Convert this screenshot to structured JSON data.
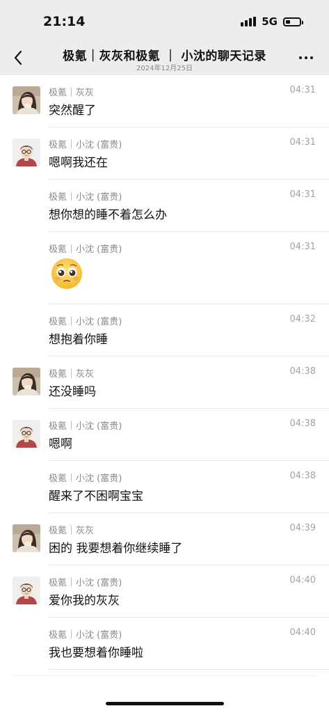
{
  "status_bar": {
    "time": "21:14",
    "network": "5G",
    "battery_level": 0.35,
    "signal_bars": 4
  },
  "nav": {
    "title": "极氪｜灰灰和极氪 ｜ 小沈的聊天记录",
    "date": "2024年12月25日",
    "back_icon": "chevron-left-icon",
    "more_icon": "more-horizontal-icon"
  },
  "messages": [
    {
      "sender": "极氪｜灰灰",
      "time": "04:31",
      "text": "突然醒了",
      "avatar": "girl-photo"
    },
    {
      "sender": "极氪｜小沈 (富贵)",
      "time": "04:31",
      "text": "嗯啊我还在",
      "avatar": "cartoon-boy"
    },
    {
      "sender": "极氪｜小沈 (富贵)",
      "time": "04:31",
      "text": "想你想的睡不着怎么办"
    },
    {
      "sender": "极氪｜小沈 (富贵)",
      "time": "04:31",
      "emoji": "pleading-face-emoji"
    },
    {
      "sender": "极氪｜小沈 (富贵)",
      "time": "04:32",
      "text": "想抱着你睡"
    },
    {
      "sender": "极氪｜灰灰",
      "time": "04:38",
      "text": "还没睡吗",
      "avatar": "girl-photo"
    },
    {
      "sender": "极氪｜小沈 (富贵)",
      "time": "04:38",
      "text": "嗯啊",
      "avatar": "cartoon-boy"
    },
    {
      "sender": "极氪｜小沈 (富贵)",
      "time": "04:38",
      "text": "醒来了不困啊宝宝"
    },
    {
      "sender": "极氪｜灰灰",
      "time": "04:39",
      "text": "困的 我要想着你继续睡了",
      "avatar": "girl-photo"
    },
    {
      "sender": "极氪｜小沈 (富贵)",
      "time": "04:40",
      "text": "爱你我的灰灰",
      "avatar": "cartoon-boy"
    },
    {
      "sender": "极氪｜小沈 (富贵)",
      "time": "04:40",
      "text": "我也要想着你睡啦"
    }
  ]
}
